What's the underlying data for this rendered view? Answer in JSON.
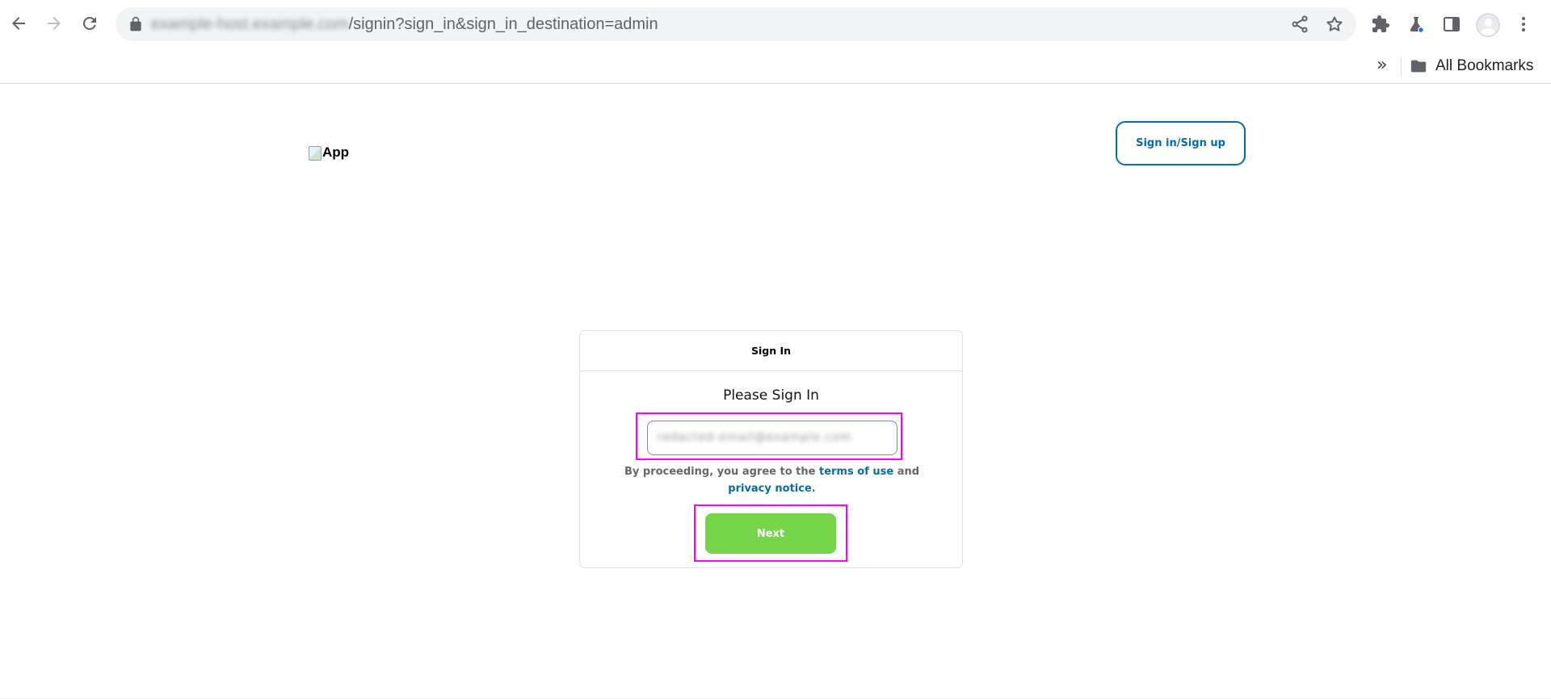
{
  "browser": {
    "url_host": "example-host.example.com",
    "url_path": "/signin?sign_in&sign_in_destination=admin",
    "bookmarks": {
      "overflow_label": "»",
      "all_bookmarks_label": "All Bookmarks"
    },
    "icons": {
      "back": "back-arrow-icon",
      "forward": "forward-arrow-icon",
      "reload": "reload-icon",
      "lock": "lock-icon",
      "share": "share-icon",
      "bookmark_star": "star-icon",
      "extensions": "puzzle-icon",
      "labs": "flask-icon",
      "side_panel": "side-panel-icon",
      "menu": "kebab-menu-icon",
      "folder": "folder-icon"
    }
  },
  "header": {
    "logo_alt": "App",
    "signin_button": "Sign in/Sign up"
  },
  "card": {
    "header": "Sign In",
    "title": "Please Sign In",
    "email_value": "redacted-email@example.com",
    "terms_prefix": "By proceeding, you agree to the ",
    "terms_link": "terms of use",
    "terms_and": " and ",
    "privacy_link": "privacy notice",
    "terms_suffix": ".",
    "next_button": "Next"
  },
  "colors": {
    "brand_blue": "#0a6aa6",
    "next_green": "#75d447",
    "highlight": "#ff00ff"
  }
}
